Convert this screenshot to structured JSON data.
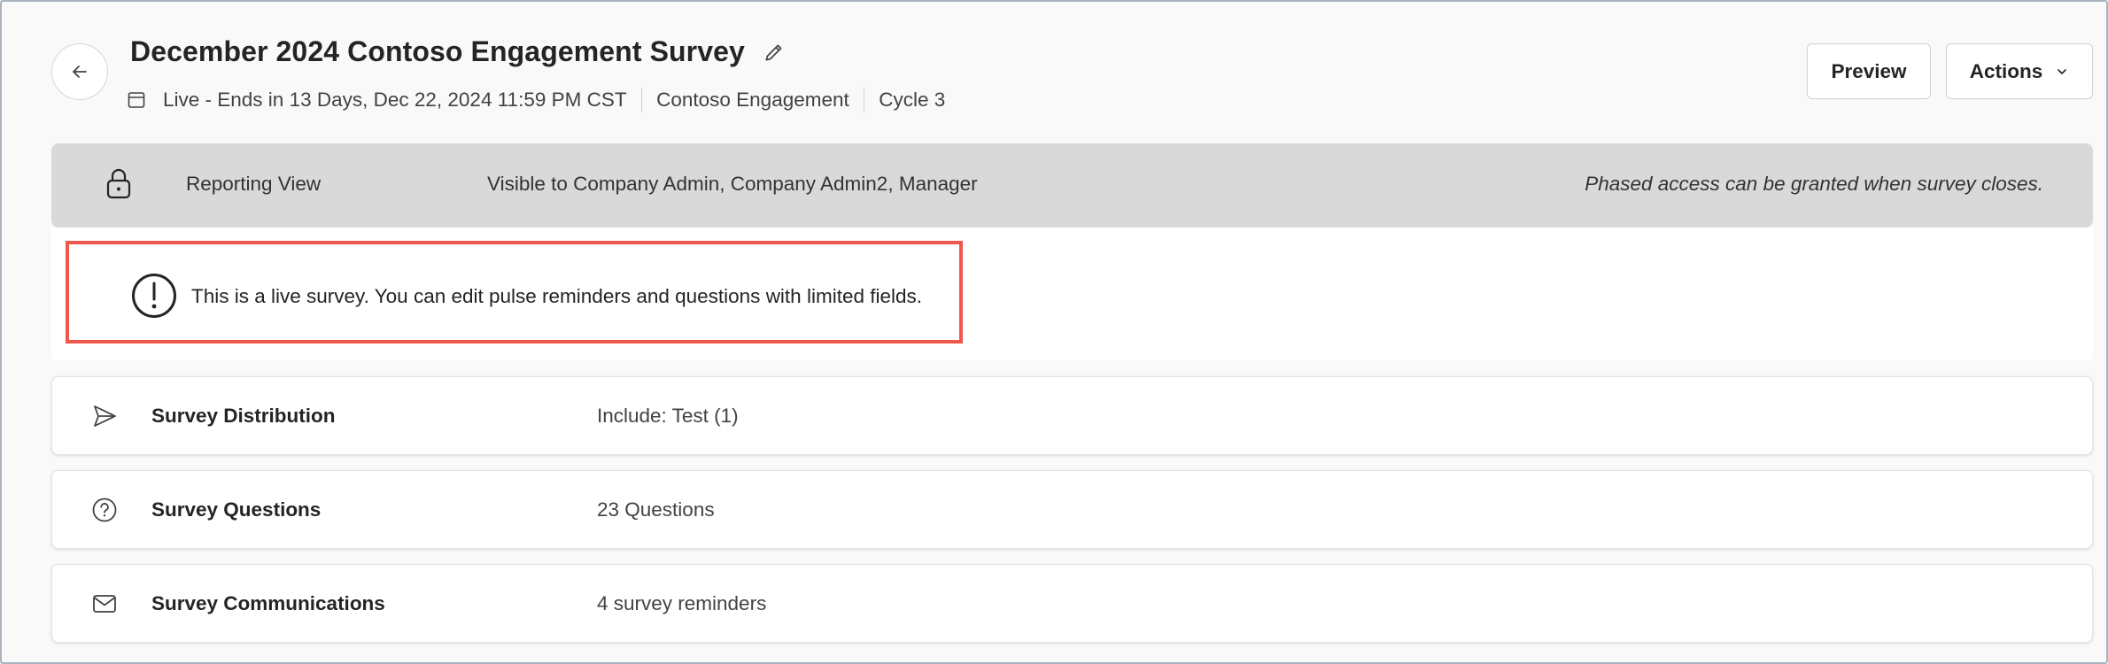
{
  "header": {
    "title": "December 2024 Contoso Engagement Survey",
    "meta": {
      "status": "Live - Ends in 13 Days, Dec 22, 2024 11:59 PM CST",
      "program": "Contoso Engagement",
      "cycle": "Cycle 3"
    },
    "icons": {
      "back": "arrow-left-icon",
      "edit": "pencil-icon",
      "calendar": "calendar-icon"
    }
  },
  "toolbar": {
    "preview_label": "Preview",
    "actions_label": "Actions"
  },
  "reporting": {
    "label": "Reporting View",
    "visibility": "Visible to Company Admin, Company Admin2, Manager",
    "note": "Phased access can be granted when survey closes.",
    "icon": "lock-icon"
  },
  "live_notice": {
    "text": "This is a live survey. You can edit pulse reminders and questions with limited fields.",
    "icon": "exclamation-circle-icon",
    "highlight_color": "#f0564a"
  },
  "sections": [
    {
      "title": "Survey Distribution",
      "value": "Include: Test (1)",
      "icon": "send-icon"
    },
    {
      "title": "Survey Questions",
      "value": "23 Questions",
      "icon": "question-circle-icon"
    },
    {
      "title": "Survey Communications",
      "value": "4 survey reminders",
      "icon": "mail-icon"
    }
  ]
}
